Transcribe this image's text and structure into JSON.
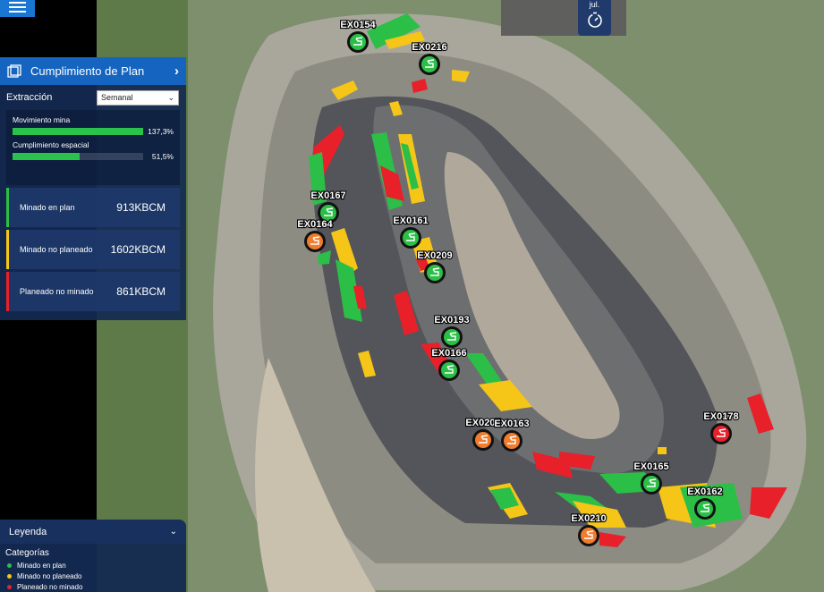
{
  "date_label": "jul.",
  "panel": {
    "title": "Cumplimiento de Plan",
    "section_label": "Extracción",
    "period_select": "Semanal",
    "metrics": [
      {
        "name": "Movimiento mina",
        "value_label": "137,3%",
        "fill": 1.0
      },
      {
        "name": "Cumplimiento espacial",
        "value_label": "51,5%",
        "fill": 0.515
      }
    ],
    "stats": [
      {
        "name": "Minado en plan",
        "value": "913KBCM",
        "color": "#2bbf48"
      },
      {
        "name": "Minado no planeado",
        "value": "1602KBCM",
        "color": "#f5c518"
      },
      {
        "name": "Planeado no minado",
        "value": "861KBCM",
        "color": "#e8202a"
      }
    ]
  },
  "legend": {
    "title": "Leyenda",
    "category_title": "Categorías",
    "items": [
      {
        "label": "Minado en plan",
        "color": "#2bbf48"
      },
      {
        "label": "Minado no planeado",
        "color": "#f5c518"
      },
      {
        "label": "Planeado no minado",
        "color": "#e8202a"
      }
    ]
  },
  "colors": {
    "green": "#2bbf48",
    "yellow": "#f5c518",
    "red": "#e8202a",
    "orange": "#f07c2e",
    "accent": "#1565c0"
  },
  "excavators": [
    {
      "id": "EX0154",
      "status": "green"
    },
    {
      "id": "EX0216",
      "status": "green"
    },
    {
      "id": "EX0167",
      "status": "green"
    },
    {
      "id": "EX0164",
      "status": "orange"
    },
    {
      "id": "EX0161",
      "status": "green"
    },
    {
      "id": "EX0209",
      "status": "green"
    },
    {
      "id": "EX0193",
      "status": "green"
    },
    {
      "id": "EX0166",
      "status": "green"
    },
    {
      "id": "EX0207",
      "status": "orange"
    },
    {
      "id": "EX0163",
      "status": "orange"
    },
    {
      "id": "EX0178",
      "status": "red"
    },
    {
      "id": "EX0165",
      "status": "green"
    },
    {
      "id": "EX0162",
      "status": "green"
    },
    {
      "id": "EX0210",
      "status": "orange"
    }
  ]
}
